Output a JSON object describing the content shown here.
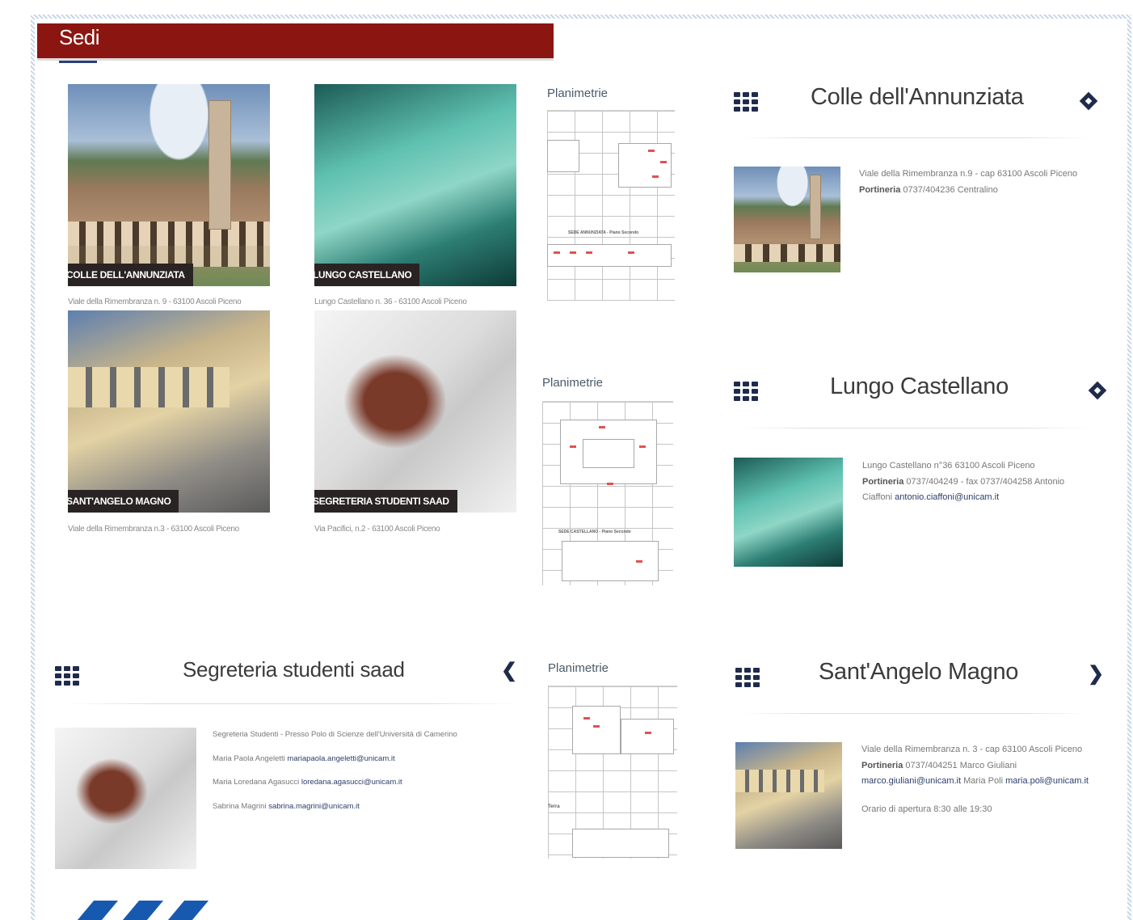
{
  "header": {
    "title": "Sedi"
  },
  "tiles": [
    {
      "caption": "COLLE DELL'ANNUNZIATA",
      "address": "Viale della Rimembranza n. 9 - 63100 Ascoli Piceno"
    },
    {
      "caption": "LUNGO CASTELLANO",
      "address": "Lungo Castellano n. 36 - 63100 Ascoli Piceno"
    },
    {
      "caption": "SANT'ANGELO MAGNO",
      "address": "Viale della Rimembranza n.3 - 63100 Ascoli Piceno"
    },
    {
      "caption": "SEGRETERIA STUDENTI SAAD",
      "address": "Via Pacifici, n.2 - 63100 Ascoli Piceno"
    }
  ],
  "plans": [
    {
      "title": "Planimetrie",
      "label": "SEDE ANNUNZIATA - Piano Secondo"
    },
    {
      "title": "Planimetrie",
      "label": "SEDE CASTELLANO - Piano Secondo"
    },
    {
      "title": "Planimetrie",
      "label": "Terra"
    }
  ],
  "panels": {
    "colle": {
      "title": "Colle dell'Annunziata",
      "address": "Viale della Rimembranza n.9 - cap 63100 Ascoli Piceno",
      "portineria_label": "Portineria",
      "portineria_text": "0737/404236 Centralino"
    },
    "lungo": {
      "title": "Lungo Castellano",
      "address": "Lungo Castellano n°36 63100 Ascoli Piceno",
      "portineria_label": "Portineria",
      "portineria_text": "0737/404249 - fax 0737/404258 Antonio Ciaffoni",
      "email": "antonio.ciaffoni@unicam.it"
    },
    "segreteria": {
      "title": "Segreteria studenti saad",
      "line1": "Segreteria Studenti - Presso Polo di Scienze dell'Università di Camerino",
      "p1_name": "Maria Paola Angeletti",
      "p1_email": "mariapaola.angeletti@unicam.it",
      "p2_name": "Maria Loredana Agasucci",
      "p2_email": "loredana.agasucci@unicam.it",
      "p3_name": "Sabrina Magrini",
      "p3_email": "sabrina.magrini@unicam.it"
    },
    "sant": {
      "title": "Sant'Angelo Magno",
      "address": "Viale della Rimembranza n. 3 - cap 63100 Ascoli Piceno",
      "portineria_label": "Portineria",
      "portineria_text": "0737/404251 Marco Giuliani",
      "email1": "marco.giuliani@unicam.it",
      "name2": "Maria Poli",
      "email2": "maria.poli@unicam.it",
      "orario": "Orario di apertura 8:30 alle 19:30"
    }
  },
  "icons": {
    "grid": "grid-icon",
    "prev": "chevron-left-icon",
    "next": "chevron-right-icon",
    "diamond": "diamond-icon"
  },
  "colors": {
    "header_bg": "#8b1511",
    "accent": "#1f2b4d",
    "stripe": "#1859b0"
  }
}
